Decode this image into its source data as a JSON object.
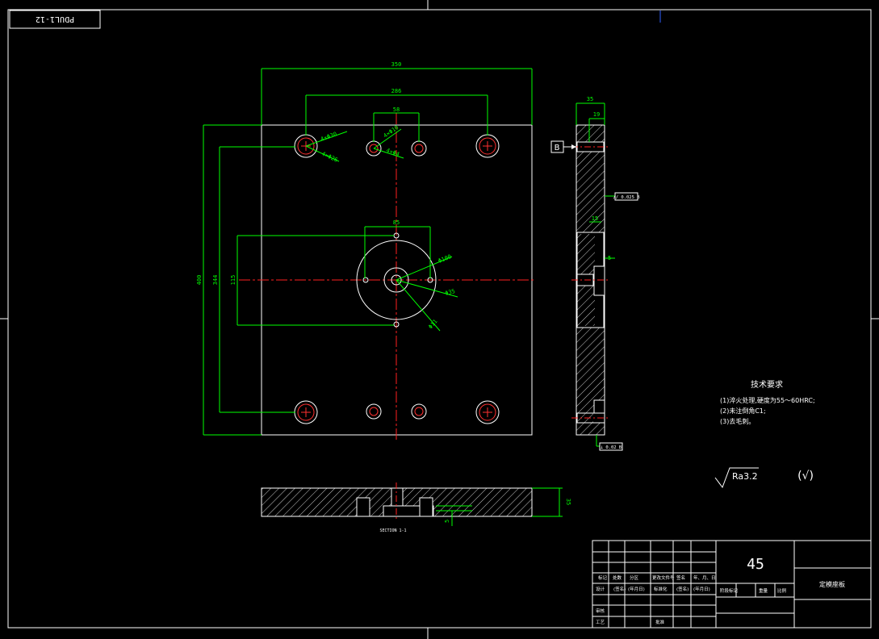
{
  "drawing_code": "PDUL1-12",
  "colors": {
    "background": "#000000",
    "outline": "#ffffff",
    "dimension": "#00ff00",
    "centerline": "#ff0000",
    "hatch": "#ffffff",
    "hole_inner": "#ff3030"
  },
  "dims": {
    "top_width": "350",
    "top_holes": "286",
    "top_small": "58",
    "center_span": "85",
    "left_height": "400",
    "left_holes": "344",
    "left_center": "115",
    "side_thickness": "35",
    "side_step": "19",
    "bottom_thickness": "35",
    "bottom_small": "5",
    "side_small": "5",
    "side_mid": "15"
  },
  "callouts": {
    "large_holes_a": "4×Φ30",
    "large_holes_b": "4×Φ26",
    "small_holes_a": "4×Φ10",
    "small_holes_b": "4×Φ4",
    "circle_outer": "Φ100",
    "circle_mid": "Φ35",
    "circle_small": "Φ11"
  },
  "datum_label": "B",
  "tolerance_1": "//  0.025  B",
  "tolerance_2": "⊥  0.02  B",
  "section_label": "SECTION 1-1",
  "tech_requirements": {
    "title": "技术要求",
    "items": [
      "(1)淬火处理,硬度为55～60HRC;",
      "(2)未注倒角C1;",
      "(3)去毛刺。"
    ]
  },
  "roughness": "Ra3.2",
  "roughness_general": "(√)",
  "title_block": {
    "material": "45",
    "part_name": "定模座板",
    "row_a": [
      "标记",
      "处数",
      "分区",
      "更改文件号",
      "签名",
      "年、月、日"
    ],
    "row_b": [
      "设计",
      "(签名)",
      "(年月日)",
      "标准化",
      "(签名)",
      "(年月日)"
    ],
    "row_c": [
      "审核",
      "",
      "",
      "",
      "",
      ""
    ],
    "row_d": [
      "工艺",
      "",
      "",
      "批准",
      "",
      ""
    ],
    "stage_labels": [
      "阶段标记",
      "重量",
      "比例"
    ]
  }
}
